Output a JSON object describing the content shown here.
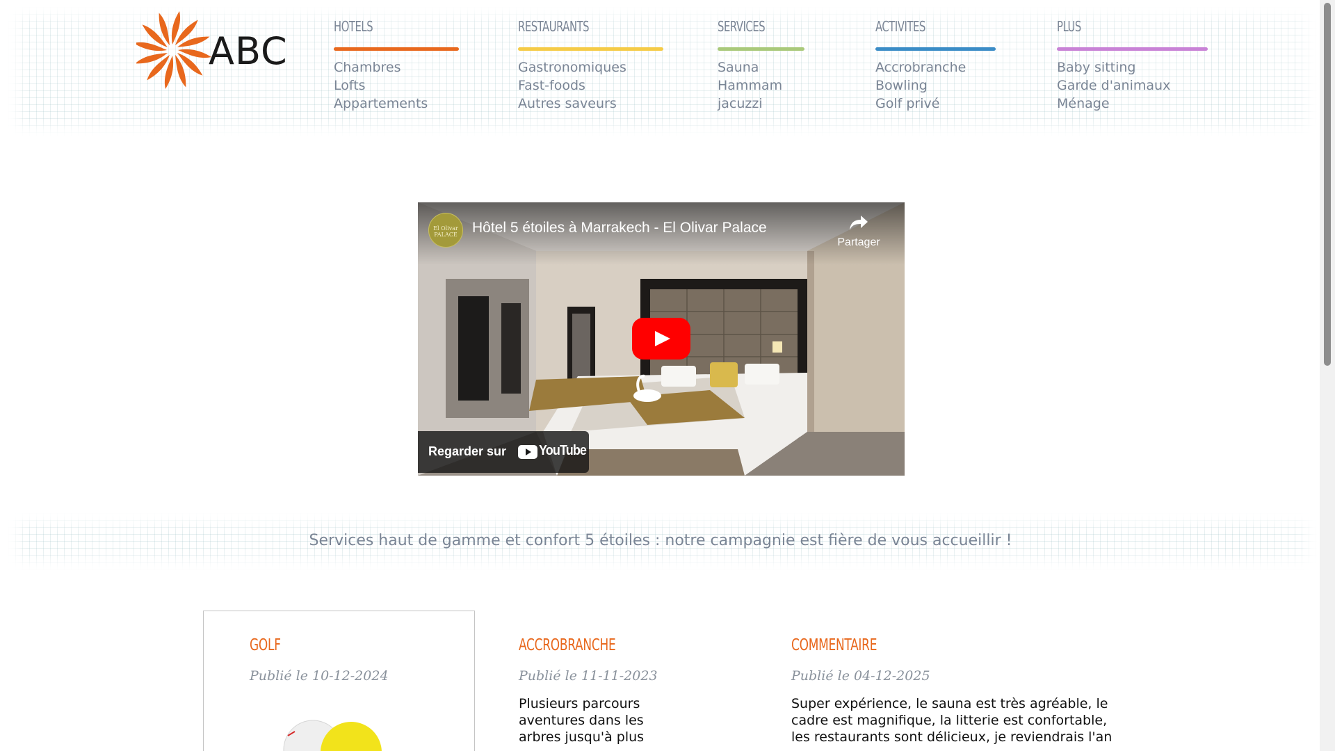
{
  "logo": {
    "text": "ABC",
    "color": "#e8681d"
  },
  "nav": [
    {
      "title": "HOTELS",
      "color": "#e8681d",
      "items": [
        "Chambres",
        "Lofts",
        "Appartements"
      ]
    },
    {
      "title": "RESTAURANTS",
      "color": "#f5cb46",
      "items": [
        "Gastronomiques",
        "Fast-foods",
        "Autres saveurs"
      ]
    },
    {
      "title": "SERVICES",
      "color": "#a9c97a",
      "items": [
        "Sauna",
        "Hammam",
        "jacuzzi"
      ]
    },
    {
      "title": "ACTIVITES",
      "color": "#3a8cc6",
      "items": [
        "Accrobranche",
        "Bowling",
        "Golf privé"
      ]
    },
    {
      "title": "PLUS",
      "color": "#c882d6",
      "items": [
        "Baby sitting",
        "Garde d'animaux",
        "Ménage"
      ]
    }
  ],
  "video": {
    "title": "Hôtel 5 étoiles à Marrakech - El Olivar Palace",
    "channel_avatar_text": "El Olivar PALACE",
    "share_label": "Partager",
    "watch_label": "Regarder sur",
    "youtube_label": "YouTube"
  },
  "tagline": "Services haut de gamme et confort 5 étoiles : notre campagnie est fière de vous accueillir !",
  "articles": [
    {
      "title": "GOLF",
      "date": "Publié le 10-12-2024",
      "text": ""
    },
    {
      "title": "ACCROBRANCHE",
      "date": "Publié le 11-11-2023",
      "text": "Plusieurs parcours aventures dans les arbres jusqu'à plus"
    },
    {
      "title": "COMMENTAIRE",
      "date": "Publié le 04-12-2025",
      "text": "Super expérience, le sauna est très agréable, le cadre est magnifique, la litterie est confortable, les restaurants sont délicieux, je reviendrais l'an"
    }
  ]
}
